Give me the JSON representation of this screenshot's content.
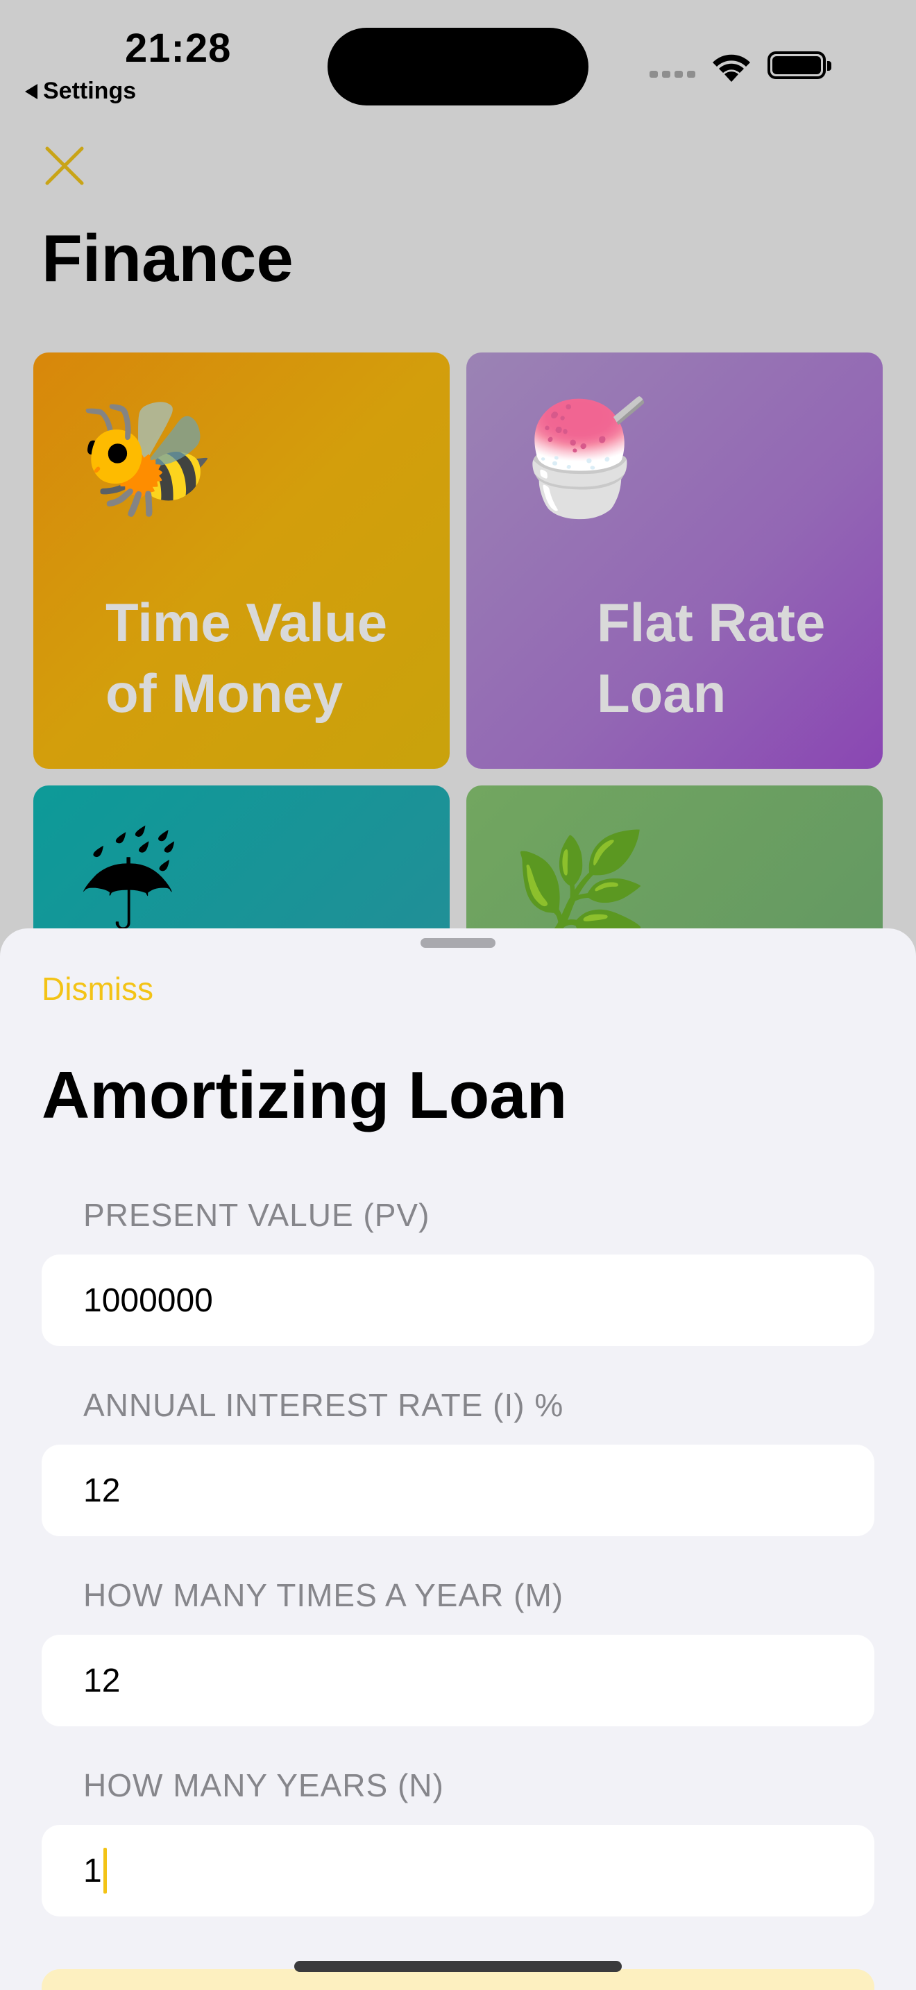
{
  "status_bar": {
    "time": "21:28",
    "back_label": "Settings"
  },
  "page": {
    "title": "Finance",
    "cards": [
      {
        "emoji": "🐝",
        "label_line1": "Time Value",
        "label_line2": "of Money"
      },
      {
        "emoji": "🍧",
        "label_line1": "Flat Rate",
        "label_line2": "Loan"
      },
      {
        "emoji": "☔",
        "label_line1": "",
        "label_line2": ""
      },
      {
        "emoji": "🌿",
        "label_line1": "",
        "label_line2": ""
      }
    ]
  },
  "sheet": {
    "dismiss_label": "Dismiss",
    "title": "Amortizing Loan",
    "fields": [
      {
        "label": "PRESENT VALUE (PV)",
        "value": "1000000"
      },
      {
        "label": "ANNUAL INTEREST RATE (I) %",
        "value": "12"
      },
      {
        "label": "HOW MANY TIMES A YEAR (M)",
        "value": "12"
      },
      {
        "label": "HOW MANY YEARS (N)",
        "value": "1"
      }
    ]
  },
  "colors": {
    "accent": "#f3c316",
    "sheet_background": "#f2f2f7",
    "label_gray": "#86868b"
  },
  "icons": {
    "close": "close-icon",
    "wifi": "wifi-icon",
    "battery": "battery-icon",
    "back": "back-triangle-icon"
  }
}
